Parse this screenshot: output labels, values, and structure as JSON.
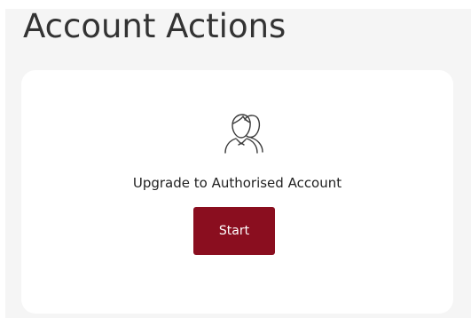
{
  "header": {
    "title": "Account Actions"
  },
  "card": {
    "icon": "users-icon",
    "label": "Upgrade to Authorised Account",
    "button_label": "Start"
  },
  "colors": {
    "background_panel": "#f5f5f5",
    "card_background": "#ffffff",
    "title_text": "#333333",
    "accent_button": "#8a0e1f",
    "button_text": "#ffffff"
  }
}
